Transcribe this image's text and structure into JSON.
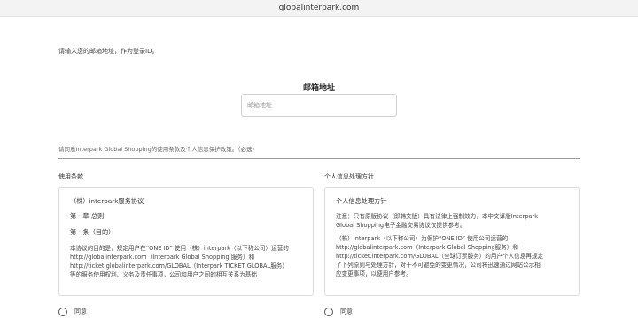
{
  "browser": {
    "url": "globalinterpark.com"
  },
  "login": {
    "prompt": "请输入您的邮箱地址，作为登录ID。",
    "email_title": "邮箱地址",
    "email_placeholder": "邮箱地址"
  },
  "agreement": {
    "notice": "请同意Interpark Global Shopping的使用条款及个人信息保护政策。（必选）"
  },
  "terms": {
    "title": "使用条款",
    "header": "（株）interpark服务协议",
    "chapter": "第一章 总则",
    "article": "第一条（目的）",
    "body": [
      "本协议的目的是，规定用户在“ONE ID” 使用（株）interpark（以下称公司）运营的",
      "http://globalinterpark.com（Interpark Global Shopping 服务）和",
      "http://ticket.globalinterpark.com/GLOBAL（Interpark TICKET GLOBAL服务）",
      "等的服务使用权利、义务及责任事项，公司和用户之间的相互关系为基础"
    ],
    "agree_label": "同意"
  },
  "privacy": {
    "title": "个人信息处理方针",
    "header": "个人信息处理方针",
    "body": [
      "注意：只有原版协议（即韩文版）具有法律上强制效力，本中文译版Interpark",
      "Global Shopping电子金融交易协议仅提供参考。",
      "",
      "（株）Interpark（以下称公司）为保护“ONE ID” 使用公司运营的",
      "http://globalinterpark.com（Interpark Global Shopping服务）和",
      "http://ticket.interpark.com/GLOBAL（全球订票服务）的用户个人信息再规定",
      "了下列原则与处理方针，对于不可避免的变更情况，公司将迅速通过网站公示相",
      "应变更事项，以便用户参考。"
    ],
    "agree_label": "同意"
  }
}
